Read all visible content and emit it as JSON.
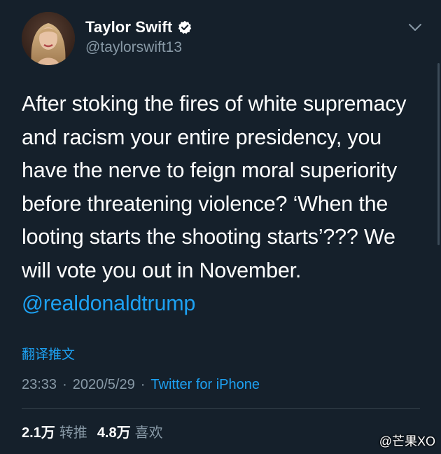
{
  "author": {
    "name": "Taylor Swift",
    "handle": "@taylorswift13",
    "verified": true
  },
  "tweet": {
    "text": "After stoking the fires of white supremacy and racism your entire presidency, you have the nerve to feign moral superiority before threatening violence? ‘When the looting starts the shooting starts’??? We will vote you out in November. ",
    "mention": "@realdonaldtrump"
  },
  "translate_label": "翻译推文",
  "meta": {
    "time": "23:33",
    "separator": "·",
    "date": "2020/5/29",
    "source": "Twitter for iPhone"
  },
  "stats": {
    "retweets_count": "2.1万",
    "retweets_label": "转推",
    "likes_count": "4.8万",
    "likes_label": "喜欢"
  },
  "watermark": "@芒果XO",
  "icons": {
    "verified": "verified-badge-icon",
    "more": "chevron-down-icon"
  },
  "colors": {
    "background": "#15202b",
    "accent": "#1da1f2",
    "secondary_text": "#8899a6"
  }
}
